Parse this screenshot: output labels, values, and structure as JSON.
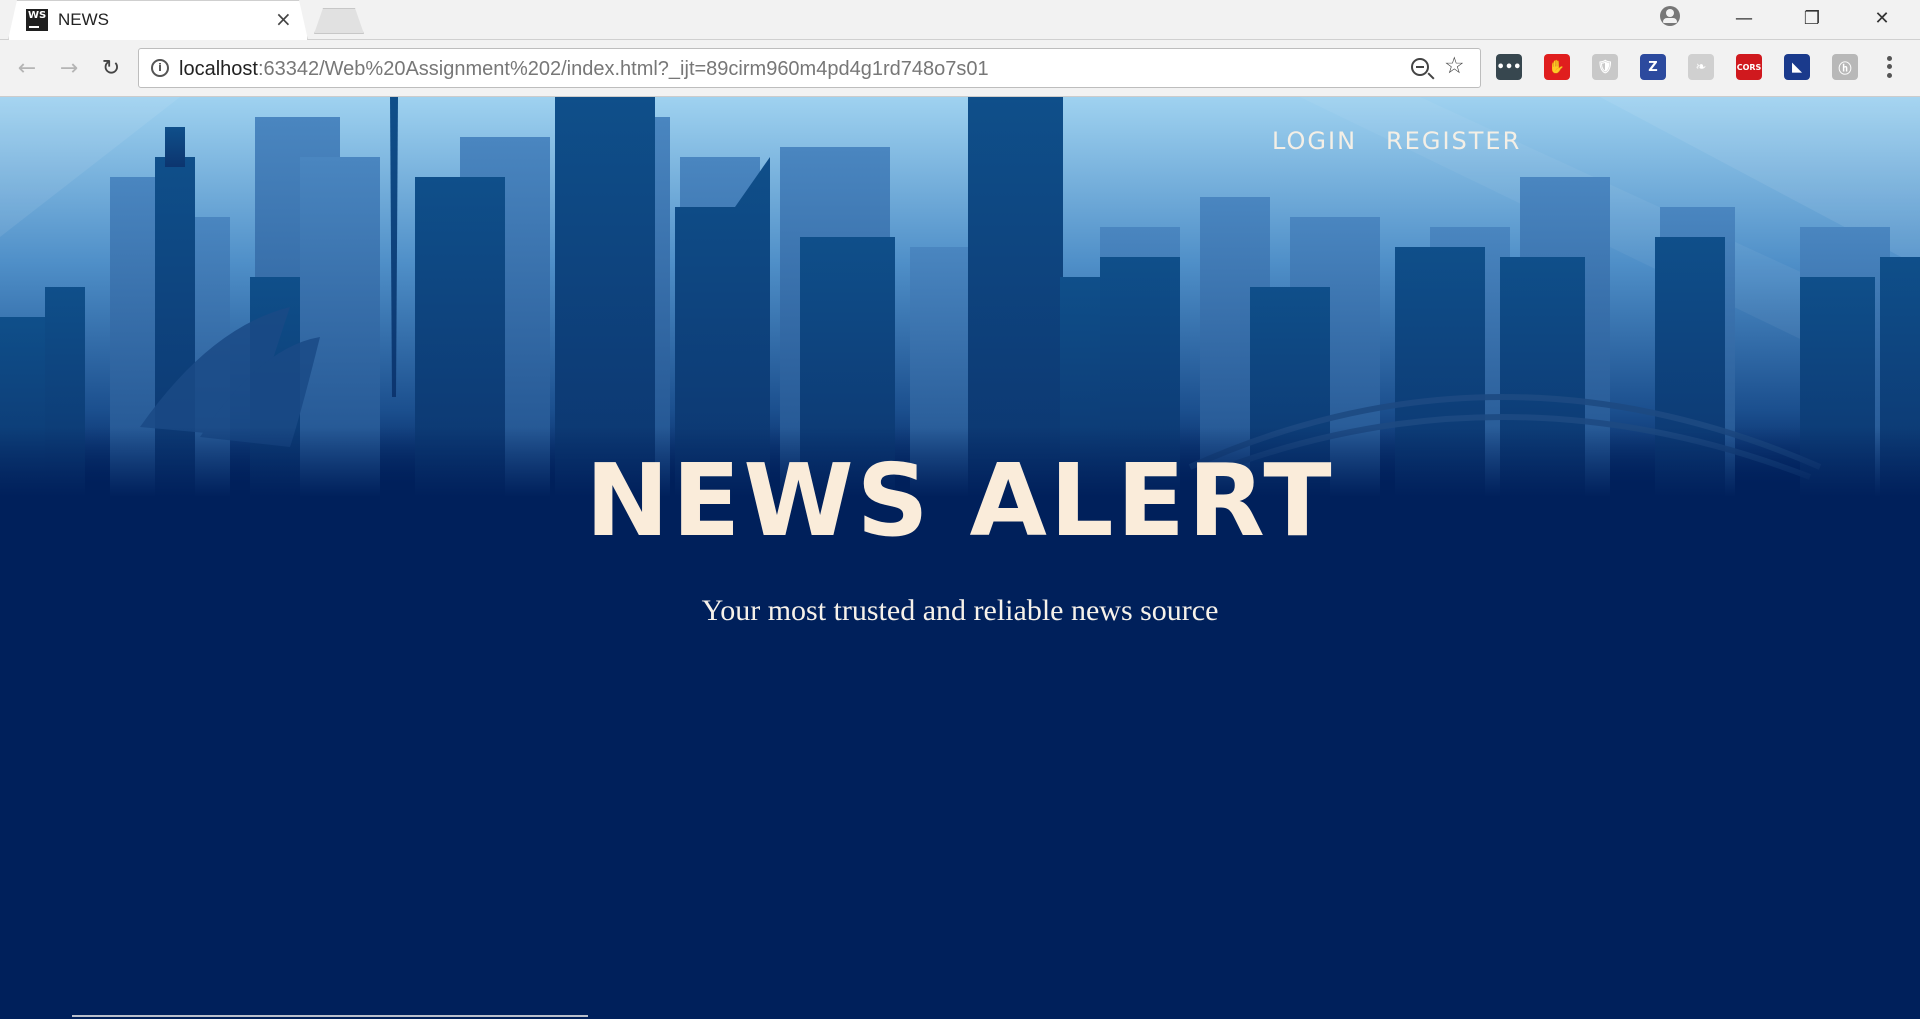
{
  "browser": {
    "tab_title": "NEWS",
    "favicon_text": "WS",
    "url_host": "localhost",
    "url_rest": ":63342/Web%20Assignment%202/index.html?_ijt=89cirm960m4pd4g1rd748o7s01",
    "window_controls": {
      "minimize": "—",
      "restore": "❐",
      "close": "✕"
    },
    "extensions": [
      {
        "name": "dots-extension-icon",
        "text": "•••",
        "color": "#37474f"
      },
      {
        "name": "adblock-extension-icon",
        "text": "✋",
        "color": "#e01e1e"
      },
      {
        "name": "shield-extension-icon",
        "text": "🛡",
        "color": "#c8c8c8"
      },
      {
        "name": "z-extension-icon",
        "text": "Z",
        "color": "#2c4a9e"
      },
      {
        "name": "feather-extension-icon",
        "text": "❧",
        "color": "#d0d0d0"
      },
      {
        "name": "cors-extension-icon",
        "text": "CORS",
        "color": "#d0191e"
      },
      {
        "name": "graph-extension-icon",
        "text": "◣",
        "color": "#1a3a8c"
      },
      {
        "name": "hk-extension-icon",
        "text": "ⓗ",
        "color": "#b8b8b8"
      }
    ]
  },
  "nav": {
    "login": "LOGIN",
    "register": "REGISTER"
  },
  "hero": {
    "title": "NEWS ALERT",
    "subtitle": "Your most trusted and reliable news source"
  },
  "colors": {
    "background": "#00205b",
    "title": "#faecda",
    "sky_top": "#9fd2f0"
  }
}
